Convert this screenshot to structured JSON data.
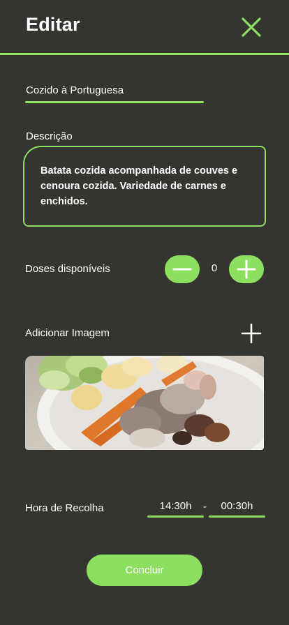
{
  "header": {
    "title": "Editar",
    "close_icon": "close-icon",
    "accent_color": "#8de05f"
  },
  "form": {
    "name_value": "Cozido à Portuguesa",
    "description_label": "Descrição",
    "description_value": "Batata cozida acompanhada de couves e cenoura cozida. Variedade de carnes e enchidos.",
    "doses_label": "Doses disponíveis",
    "doses_value": "0",
    "add_image_label": "Adicionar Imagem",
    "pickup_label": "Hora de Recolha",
    "pickup_start": "14:30h",
    "pickup_separator": "-",
    "pickup_end": "00:30h"
  },
  "actions": {
    "conclude_label": "Concluir"
  },
  "colors": {
    "background": "#343431",
    "accent": "#8de05f",
    "text": "#ffffff"
  }
}
